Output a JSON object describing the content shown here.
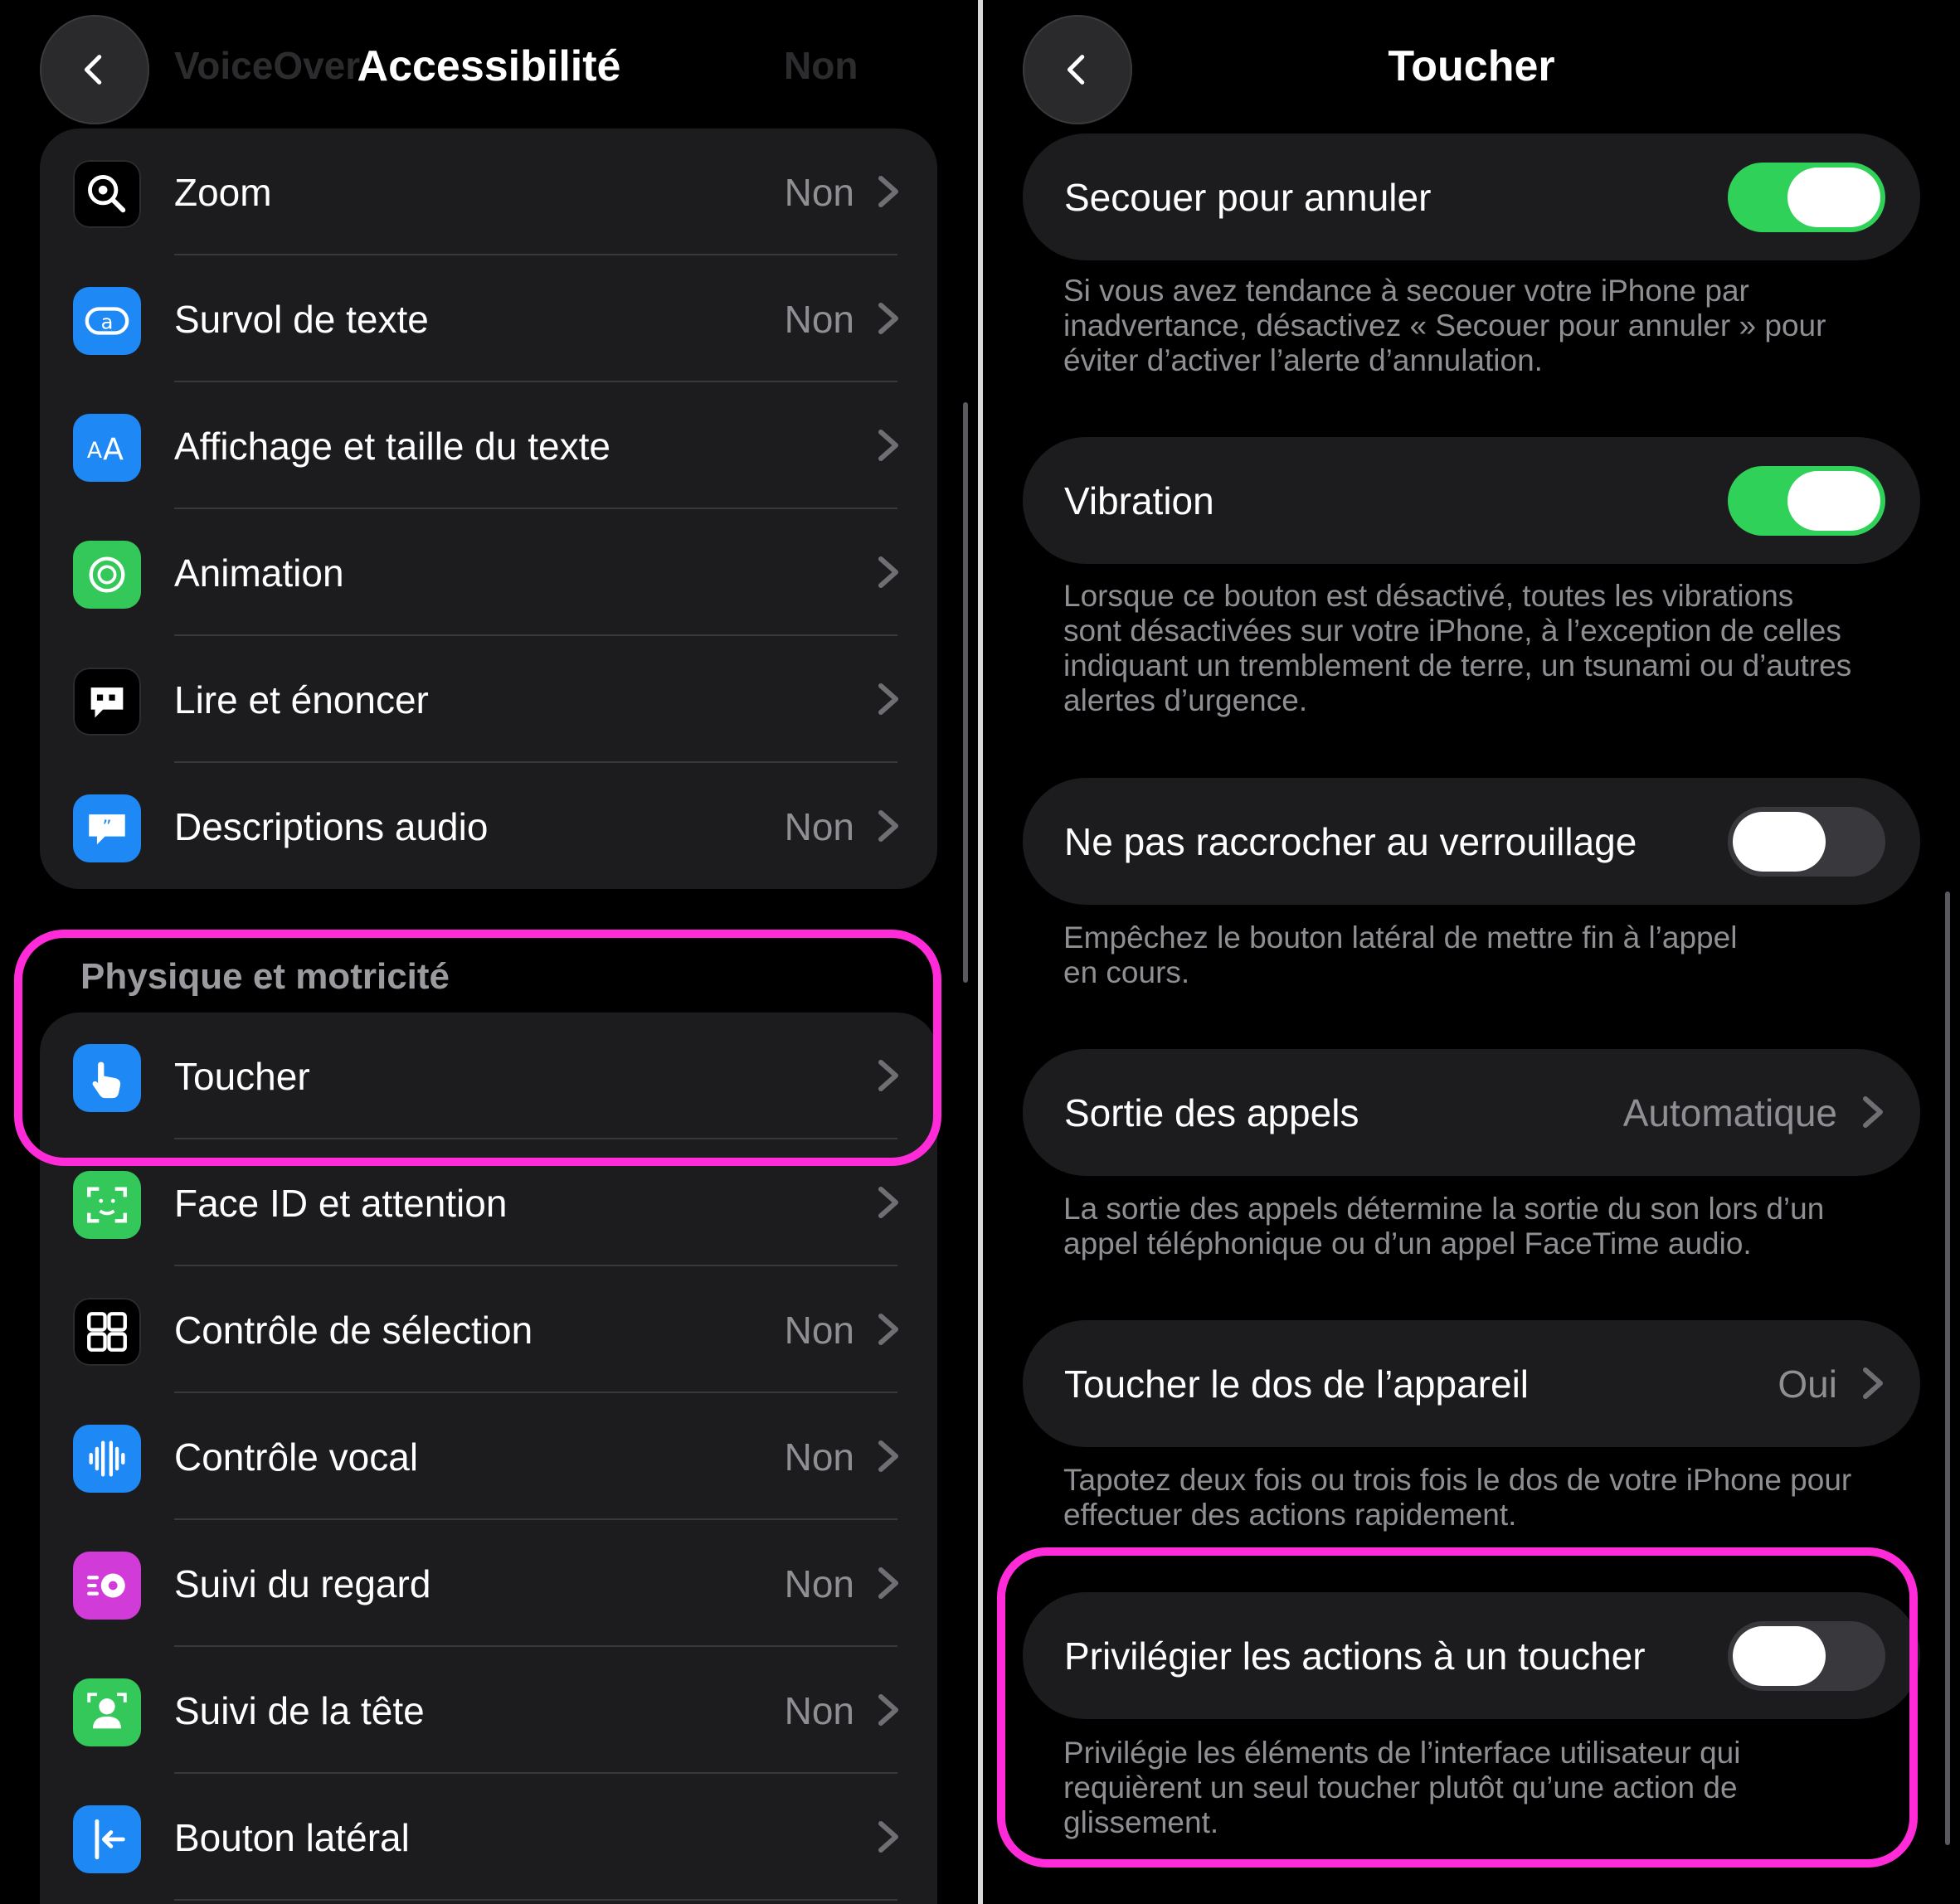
{
  "left": {
    "title": "Accessibilité",
    "ghost_label": "VoiceOver",
    "ghost_value": "Non",
    "items_top": [
      {
        "label": "Zoom",
        "value": "Non",
        "icon": "zoom-icon",
        "color": "#000000"
      },
      {
        "label": "Survol de texte",
        "value": "Non",
        "icon": "hover-text-icon",
        "color": "#1e88f5"
      },
      {
        "label": "Affichage et taille du texte",
        "value": "",
        "icon": "text-size-icon",
        "color": "#1e88f5"
      },
      {
        "label": "Animation",
        "value": "",
        "icon": "animation-icon",
        "color": "#34c759"
      },
      {
        "label": "Lire et énoncer",
        "value": "",
        "icon": "speech-bubble-icon",
        "color": "#000000"
      },
      {
        "label": "Descriptions audio",
        "value": "Non",
        "icon": "audio-description-icon",
        "color": "#1e88f5"
      }
    ],
    "section_header": "Physique et motricité",
    "items_bottom": [
      {
        "label": "Toucher",
        "value": "",
        "icon": "touch-hand-icon",
        "color": "#1e88f5"
      },
      {
        "label": "Face ID et attention",
        "value": "",
        "icon": "face-id-icon",
        "color": "#34c759"
      },
      {
        "label": "Contrôle de sélection",
        "value": "Non",
        "icon": "switch-control-icon",
        "color": "#000000"
      },
      {
        "label": "Contrôle vocal",
        "value": "Non",
        "icon": "voice-control-icon",
        "color": "#1e88f5"
      },
      {
        "label": "Suivi du regard",
        "value": "Non",
        "icon": "eye-tracking-icon",
        "color": "#d13bd8"
      },
      {
        "label": "Suivi de la tête",
        "value": "Non",
        "icon": "head-tracking-icon",
        "color": "#34c759"
      },
      {
        "label": "Bouton latéral",
        "value": "",
        "icon": "side-button-icon",
        "color": "#1e88f5"
      }
    ]
  },
  "right": {
    "title": "Toucher",
    "settings": [
      {
        "label": "Secouer pour annuler",
        "type": "toggle",
        "on": true,
        "desc": [
          "Si vous avez tendance à secouer votre iPhone par",
          "inadvertance, désactivez « Secouer pour annuler » pour",
          "éviter d’activer l’alerte d’annulation."
        ]
      },
      {
        "label": "Vibration",
        "type": "toggle",
        "on": true,
        "desc": [
          "Lorsque ce bouton est désactivé, toutes les vibrations",
          "sont désactivées sur votre iPhone, à l’exception de celles",
          "indiquant un tremblement de terre, un tsunami ou d’autres",
          "alertes d’urgence."
        ]
      },
      {
        "label": "Ne pas raccrocher au verrouillage",
        "type": "toggle",
        "on": false,
        "desc": [
          "Empêchez le bouton latéral de mettre fin à l’appel",
          "en cours."
        ]
      },
      {
        "label": "Sortie des appels",
        "type": "link",
        "value": "Automatique",
        "desc": [
          "La sortie des appels détermine la sortie du son lors d’un",
          "appel téléphonique ou d’un appel FaceTime audio."
        ]
      },
      {
        "label": "Toucher le dos de l’appareil",
        "type": "link",
        "value": "Oui",
        "desc": [
          "Tapotez deux fois ou trois fois le dos de votre iPhone pour",
          "effectuer des actions rapidement."
        ]
      },
      {
        "label": "Privilégier les actions à un toucher",
        "type": "toggle",
        "on": false,
        "desc": [
          "Privilégie les éléments de l’interface utilisateur qui",
          "requièrent un seul toucher plutôt qu’une action de",
          "glissement."
        ]
      }
    ]
  },
  "colors": {
    "highlight": "#ff2bd8",
    "toggle_on": "#30d158",
    "toggle_off": "#39393d",
    "cell_background": "#1c1c1e",
    "secondary_text": "#8e8e93"
  }
}
